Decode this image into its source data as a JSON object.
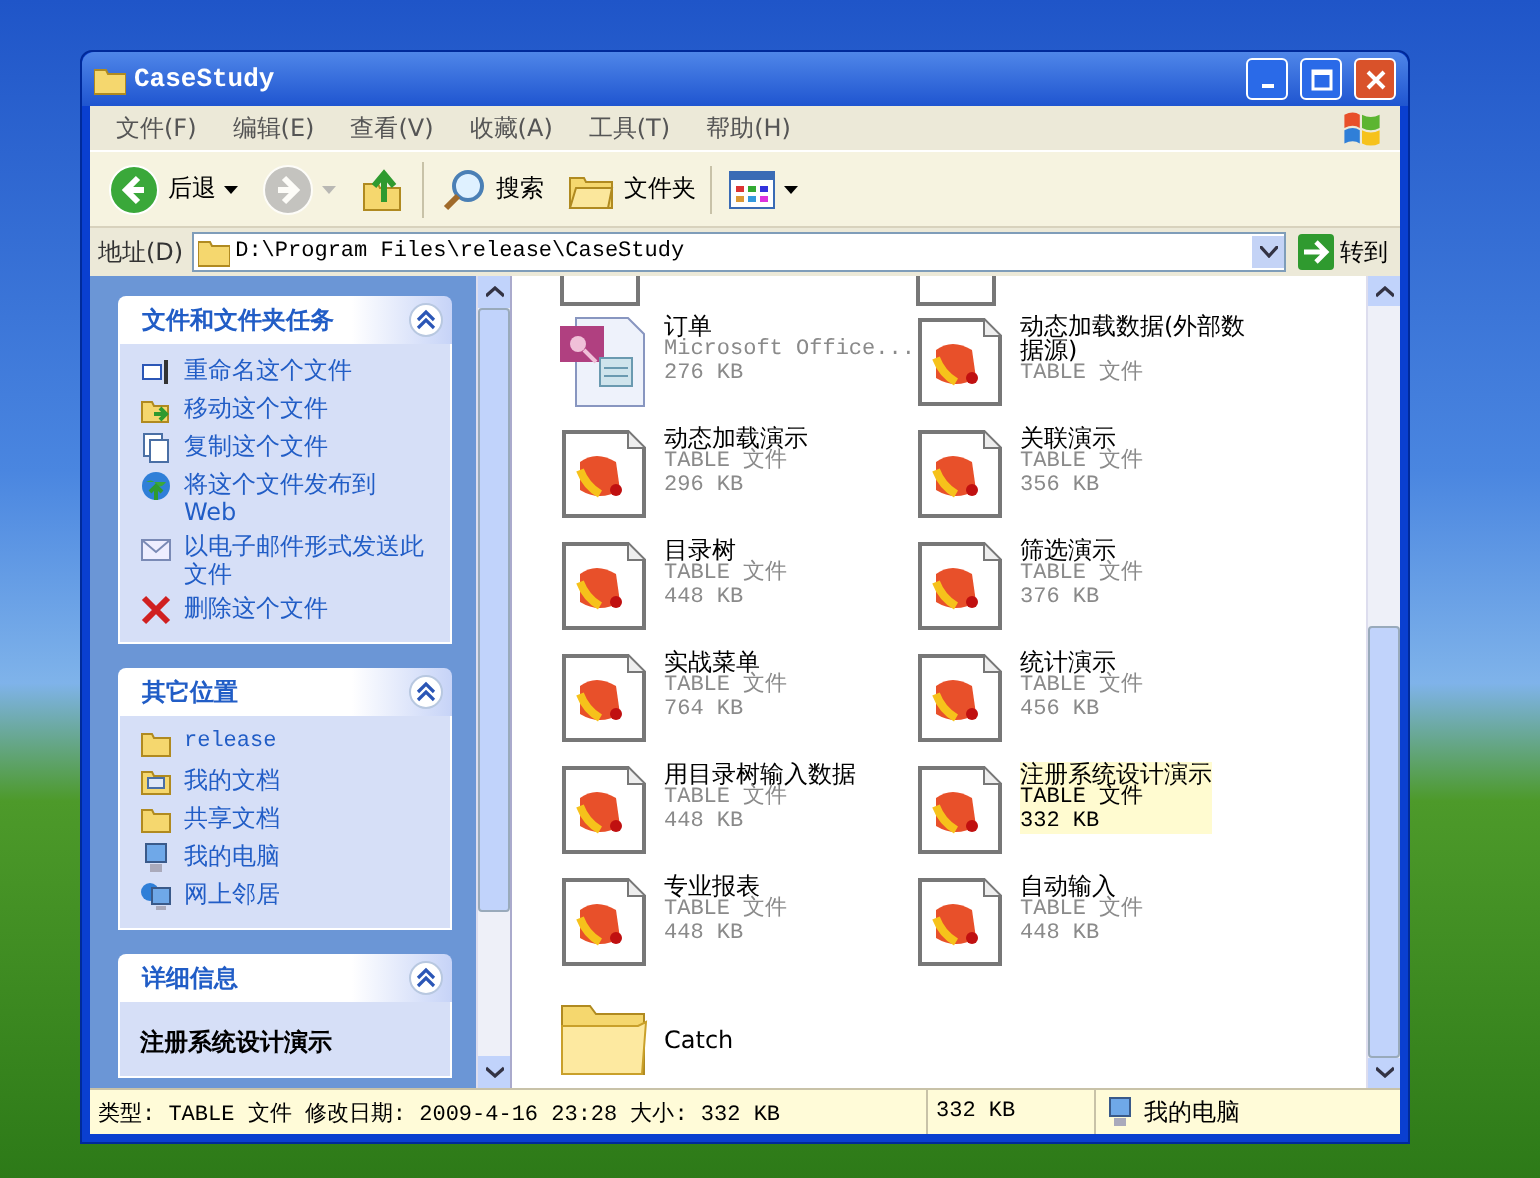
{
  "window": {
    "title": "CaseStudy"
  },
  "menu": [
    {
      "label": "文件(F)"
    },
    {
      "label": "编辑(E)"
    },
    {
      "label": "查看(V)"
    },
    {
      "label": "收藏(A)"
    },
    {
      "label": "工具(T)"
    },
    {
      "label": "帮助(H)"
    }
  ],
  "toolbar": [
    {
      "kind": "back",
      "label": "后退",
      "disabled": false
    },
    {
      "kind": "forward",
      "disabled": true
    },
    {
      "kind": "up",
      "disabled": false
    },
    {
      "kind": "search",
      "label": "搜索",
      "disabled": false
    },
    {
      "kind": "folders",
      "label": "文件夹",
      "disabled": false
    },
    {
      "kind": "views",
      "disabled": false
    }
  ],
  "address": {
    "label": "地址(D)",
    "value": "D:\\Program Files\\release\\CaseStudy",
    "go": "转到"
  },
  "sidebar": {
    "panels": [
      {
        "title": "文件和文件夹任务",
        "expanded": true,
        "items": [
          {
            "kind": "rename",
            "label": "重命名这个文件"
          },
          {
            "kind": "move",
            "label": "移动这个文件"
          },
          {
            "kind": "copy",
            "label": "复制这个文件"
          },
          {
            "kind": "publish",
            "label": "将这个文件发布到 Web"
          },
          {
            "kind": "email",
            "label": "以电子邮件形式发送此文件"
          },
          {
            "kind": "delete",
            "label": "删除这个文件"
          }
        ]
      },
      {
        "title": "其它位置",
        "expanded": true,
        "items": [
          {
            "kind": "folder",
            "label": "release"
          },
          {
            "kind": "documents",
            "label": "我的文档"
          },
          {
            "kind": "folder",
            "label": "共享文档"
          },
          {
            "kind": "computer",
            "label": "我的电脑"
          },
          {
            "kind": "network",
            "label": "网上邻居"
          }
        ]
      },
      {
        "title": "详细信息",
        "expanded": true,
        "text": "注册系统设计演示"
      }
    ]
  },
  "files": [
    {
      "kind": "access",
      "name": "订单",
      "type": "Microsoft Office...",
      "size": "276 KB",
      "selected": false
    },
    {
      "kind": "table",
      "name": "动态加载数据(外部数据源)",
      "type": "TABLE 文件",
      "selected": false
    },
    {
      "kind": "table",
      "name": "动态加载演示",
      "type": "TABLE 文件",
      "size": "296 KB",
      "selected": false
    },
    {
      "kind": "table",
      "name": "关联演示",
      "type": "TABLE 文件",
      "size": "356 KB",
      "selected": false
    },
    {
      "kind": "table",
      "name": "目录树",
      "type": "TABLE 文件",
      "size": "448 KB",
      "selected": false
    },
    {
      "kind": "table",
      "name": "筛选演示",
      "type": "TABLE 文件",
      "size": "376 KB",
      "selected": false
    },
    {
      "kind": "table",
      "name": "实战菜单",
      "type": "TABLE 文件",
      "size": "764 KB",
      "selected": false
    },
    {
      "kind": "table",
      "name": "统计演示",
      "type": "TABLE 文件",
      "size": "456 KB",
      "selected": false
    },
    {
      "kind": "table",
      "name": "用目录树输入数据",
      "type": "TABLE 文件",
      "size": "448 KB",
      "selected": false
    },
    {
      "kind": "table",
      "name": "注册系统设计演示",
      "type": "TABLE 文件",
      "size": "332 KB",
      "selected": true
    },
    {
      "kind": "table",
      "name": "专业报表",
      "type": "TABLE 文件",
      "size": "448 KB",
      "selected": false
    },
    {
      "kind": "table",
      "name": "自动输入",
      "type": "TABLE 文件",
      "size": "448 KB",
      "selected": false
    },
    {
      "kind": "folder",
      "name": "Catch",
      "selected": false
    }
  ],
  "status_bar": [
    {
      "kind": "info",
      "text": "类型: TABLE 文件 修改日期: 2009-4-16 23:28 大小: 332 KB"
    },
    {
      "kind": "size",
      "text": "332 KB"
    },
    {
      "kind": "zone",
      "text": "我的电脑"
    }
  ]
}
